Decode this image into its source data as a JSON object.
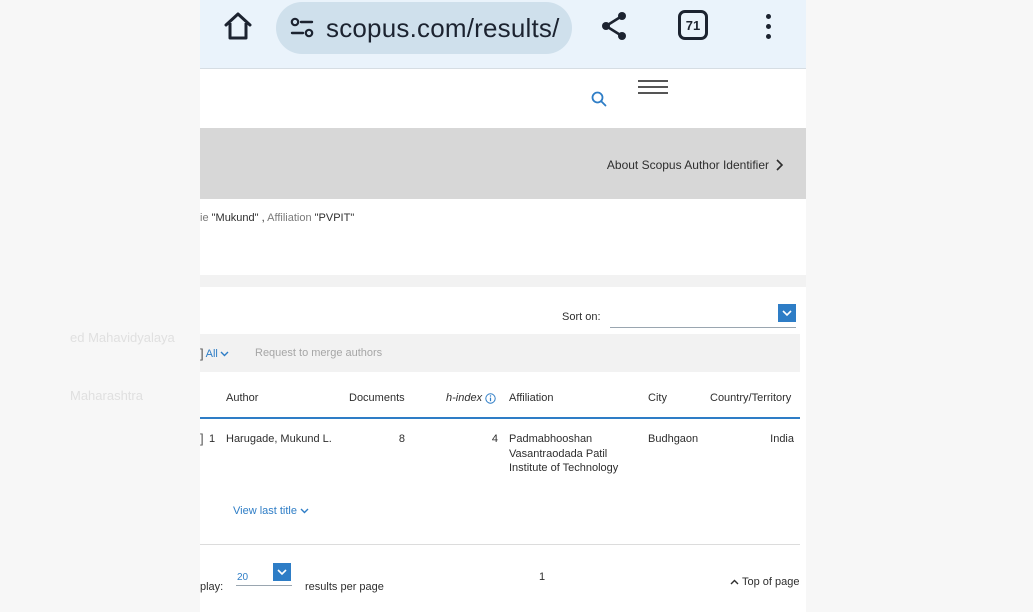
{
  "browser": {
    "url": "scopus.com/results/",
    "tab_count": "71",
    "icons": [
      "home-icon",
      "site-settings-icon",
      "share-icon",
      "tabs-icon",
      "more-vert-icon"
    ]
  },
  "header": {
    "icons": [
      "search-icon",
      "hamburger-menu-icon"
    ],
    "about_link": "About Scopus Author Identifier"
  },
  "query": {
    "prefix_partial": "ie ",
    "name_value": "\"Mukund\"",
    "separator": " , ",
    "affiliation_label": "Affiliation ",
    "affiliation_value": "\"PVPIT\""
  },
  "sort": {
    "label": "Sort on:",
    "value": ""
  },
  "toolbar": {
    "select_all_label": "All",
    "merge_label": "Request to merge authors"
  },
  "table": {
    "columns": {
      "author": "Author",
      "documents": "Documents",
      "h_index": "h-index",
      "affiliation": "Affiliation",
      "city": "City",
      "country": "Country/Territory"
    },
    "rows": [
      {
        "index": "1",
        "author": "Harugade, Mukund L.",
        "documents": "8",
        "h_index": "4",
        "affiliation_lines": [
          "Padmabhooshan",
          "Vasantraodada Patil",
          "Institute of Technology"
        ],
        "city": "Budhgaon",
        "country": "India",
        "view_last_title": "View last title"
      }
    ]
  },
  "footer": {
    "display_label_partial": "play:",
    "per_page_value": "20",
    "per_page_label": "results per page",
    "current_page": "1",
    "top_of_page": "Top of page"
  },
  "colors": {
    "accent": "#2e7dc6",
    "browser_bar": "#eaf3fb",
    "url_pill": "#cfe0ec",
    "grey_band": "#d7d7d7"
  }
}
